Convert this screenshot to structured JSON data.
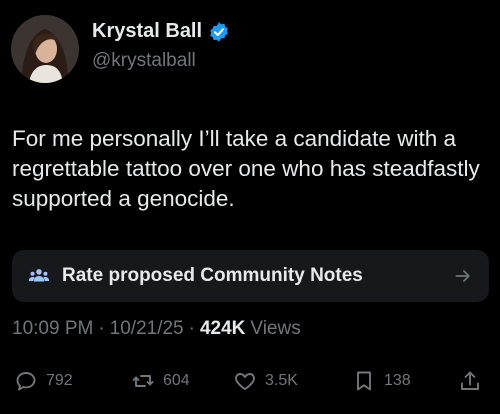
{
  "author": {
    "name": "Krystal Ball",
    "handle": "@krystalball",
    "verified": true,
    "avatar_icon": "avatar-photo"
  },
  "tweet": {
    "text": "For me personally I’ll take a candidate with a regrettable tattoo over one who has steadfastly supported a genocide."
  },
  "community_notes": {
    "label": "Rate proposed Community Notes",
    "icon": "people-icon",
    "arrow_icon": "arrow-right-icon"
  },
  "meta": {
    "time": "10:09 PM",
    "separator": "·",
    "date": "10/21/25",
    "views_count": "424K",
    "views_label": "Views"
  },
  "actions": {
    "replies": "792",
    "reposts": "604",
    "likes": "3.5K",
    "bookmarks": "138"
  },
  "colors": {
    "background": "#000000",
    "text_primary": "#e7e9ea",
    "text_secondary": "#71767b",
    "card_background": "#16181c",
    "verified_blue": "#1d9bf0"
  }
}
